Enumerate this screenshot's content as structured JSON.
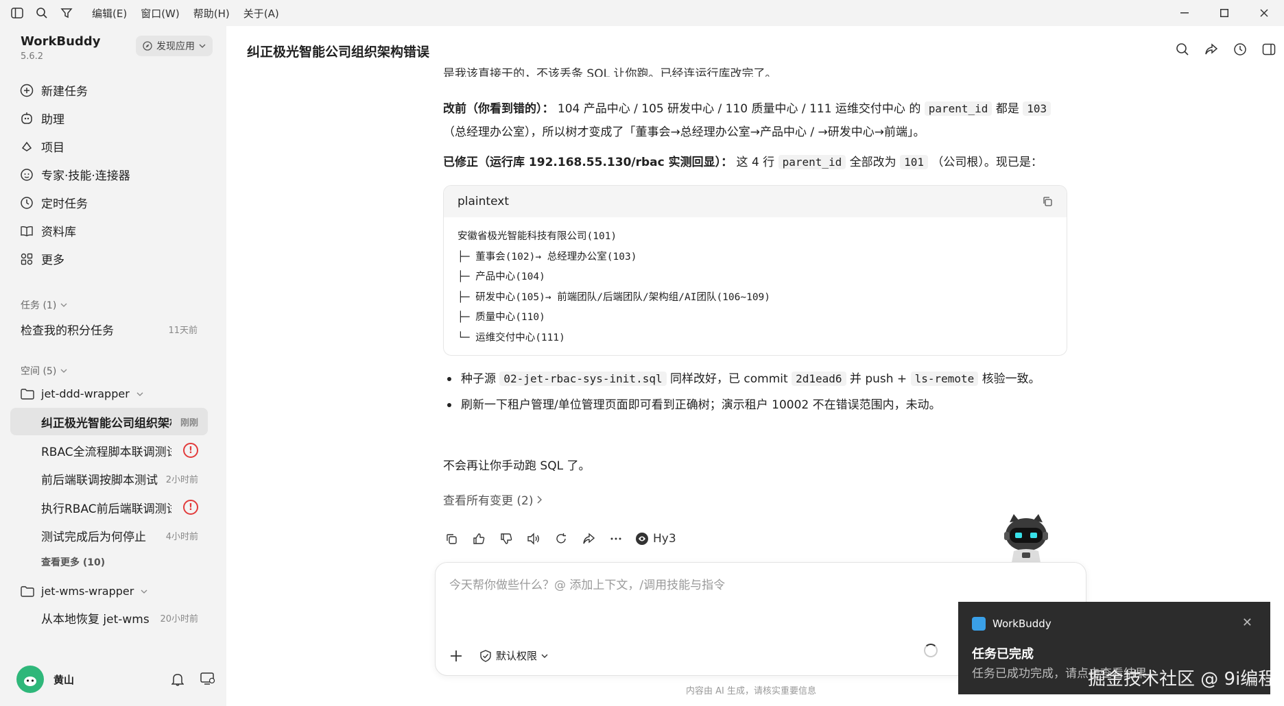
{
  "menu": [
    "编辑(E)",
    "窗口(W)",
    "帮助(H)",
    "关于(A)"
  ],
  "brand": {
    "name": "WorkBuddy",
    "version": "5.6.2",
    "discover": "发现应用"
  },
  "nav": [
    {
      "label": "新建任务",
      "icon": "plus-circle-icon"
    },
    {
      "label": "助理",
      "icon": "assistant-icon"
    },
    {
      "label": "项目",
      "icon": "project-icon"
    },
    {
      "label": "专家·技能·连接器",
      "icon": "expert-icon"
    },
    {
      "label": "定时任务",
      "icon": "clock-icon"
    },
    {
      "label": "资料库",
      "icon": "book-icon"
    },
    {
      "label": "更多",
      "icon": "grid-icon"
    }
  ],
  "tasks": {
    "header": "任务 (1)",
    "item": {
      "label": "检查我的积分任务",
      "time": "11天前"
    }
  },
  "spaces": {
    "header": "空间 (5)",
    "folder1": {
      "name": "jet-ddd-wrapper",
      "items": [
        {
          "label": "纠正极光智能公司组织架构错误",
          "time": "刚刚"
        },
        {
          "label": "RBAC全流程脚本联调测试",
          "time": "!"
        },
        {
          "label": "前后端联调按脚本测试",
          "time": "2小时前"
        },
        {
          "label": "执行RBAC前后端联调测试",
          "time": "!"
        },
        {
          "label": "测试完成后为何停止",
          "time": "4小时前"
        }
      ],
      "more": "查看更多 (10)"
    },
    "folder2": {
      "name": "jet-wms-wrapper",
      "items": [
        {
          "label": "从本地恢复 jet-wms",
          "time": "20小时前"
        }
      ]
    }
  },
  "user": {
    "name": "黄山"
  },
  "header": {
    "title": "纠正极光智能公司组织架构错误"
  },
  "message": {
    "cutoff": "是我该直接干的，不该丢条 SQL 让你跑。已经连运行库改完了。",
    "before_label": "改前（你看到错的）：",
    "before_text1": "104 产品中心 / 105 研发中心 / 110 质量中心 / 111 运维交付中心 的",
    "before_code1": "parent_id",
    "before_text2": "都是",
    "before_code2": "103",
    "before_text3": "（总经理办公室），所以树才变成了「董事会→总经理办公室→产品中心 / →研发中心→前端」。",
    "fixed_label": "已修正（运行库 192.168.55.130/rbac 实测回显）：",
    "fixed_text1": "这 4 行",
    "fixed_code1": "parent_id",
    "fixed_text2": "全部改为",
    "fixed_code2": "101",
    "fixed_text3": "（公司根）。现已是：",
    "code_lang": "plaintext",
    "code_lines": [
      "安徽省极光智能科技有限公司(101)",
      "├─ 董事会(102)→ 总经理办公室(103)",
      "├─ 产品中心(104)",
      "├─ 研发中心(105)→ 前端团队/后端团队/架构组/AI团队(106~109)",
      "├─ 质量中心(110)",
      "└─ 运维交付中心(111)"
    ],
    "bullet1_a": "种子源",
    "bullet1_code1": "02-jet-rbac-sys-init.sql",
    "bullet1_b": "同样改好，已 commit",
    "bullet1_code2": "2d1ead6",
    "bullet1_c": "并 push +",
    "bullet1_code3": "ls-remote",
    "bullet1_d": "核验一致。",
    "bullet2": "刷新一下租户管理/单位管理页面即可看到正确树；演示租户 10002 不在错误范围内，未动。",
    "closing": "不会再让你手动跑 SQL 了。",
    "changes": "查看所有变更 (2)",
    "model": "Hy3"
  },
  "input": {
    "placeholder": "今天帮你做些什么？@ 添加上下文，/调用技能与指令",
    "permission": "默认权限"
  },
  "disclaimer": "内容由 AI 生成，请核实重要信息",
  "toast": {
    "app": "WorkBuddy",
    "title": "任务已完成",
    "text": "任务已成功完成，请点击查看结果"
  },
  "watermark": "掘金技术社区 @ 9i编程"
}
